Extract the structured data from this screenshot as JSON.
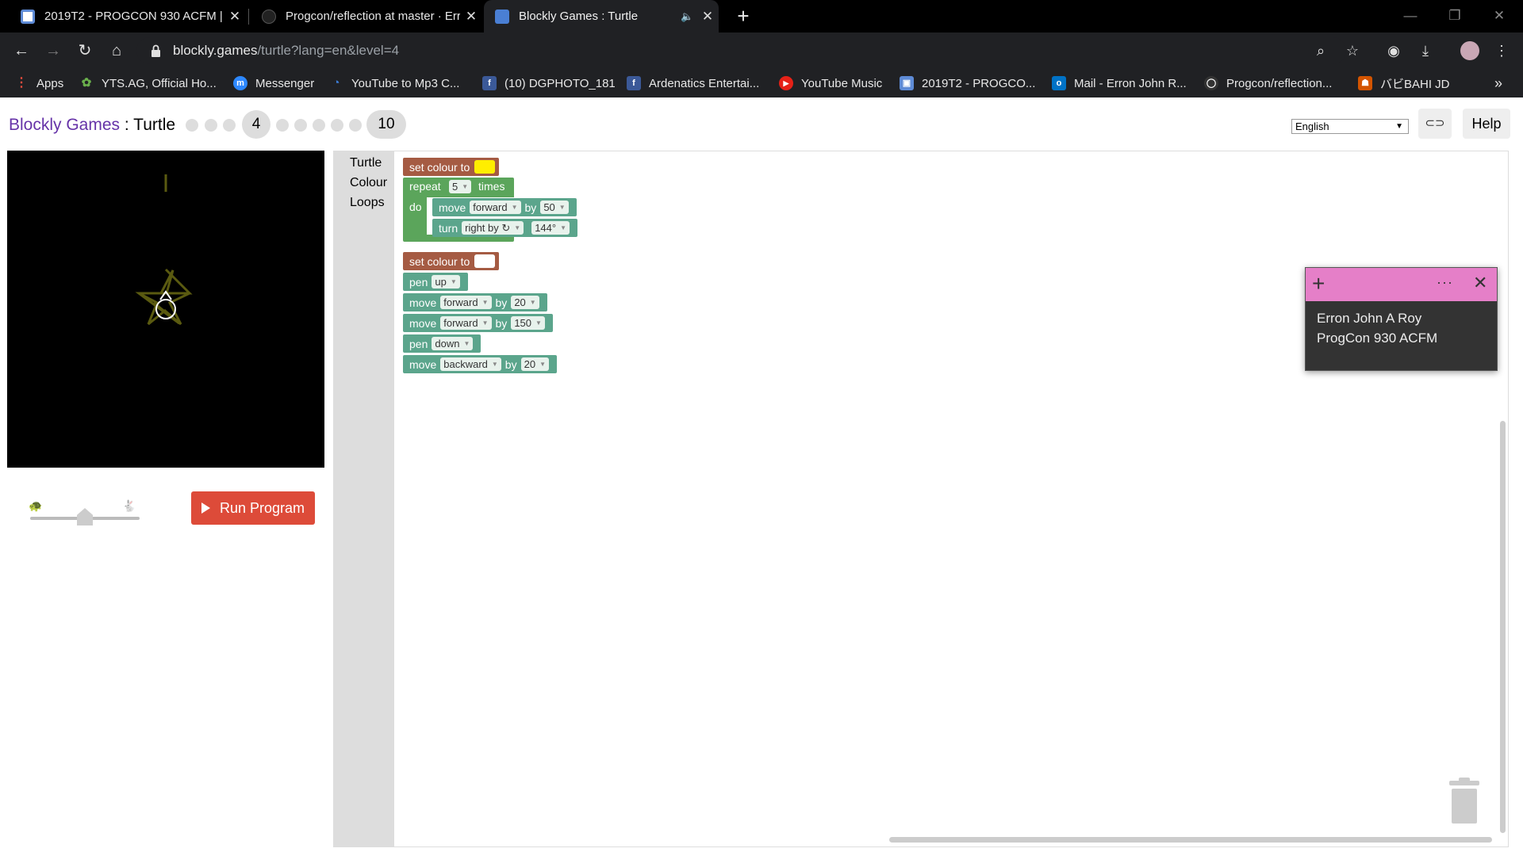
{
  "tabs": [
    {
      "title": "2019T2 - PROGCON 930 ACFM |",
      "close": "✕",
      "favicon_color": "#5e8bd6"
    },
    {
      "title": "Progcon/reflection at master · Err",
      "close": "✕",
      "favicon_color": "#333333"
    },
    {
      "title": "Blockly Games : Turtle",
      "close": "✕",
      "favicon_color": "#4a7fd4",
      "audio": "🔈"
    }
  ],
  "new_tab": "+",
  "window_controls": {
    "minimize": "—",
    "maximize": "❐",
    "close": "✕"
  },
  "address": {
    "host": "blockly.games",
    "path": "/turtle?lang=en&level=4"
  },
  "bookmarks": [
    {
      "label": "Apps",
      "color": "#e84c3d",
      "glyph": "⋮"
    },
    {
      "label": "YTS.AG, Official Ho...",
      "color": "#6ab04c",
      "glyph": "✿"
    },
    {
      "label": "Messenger",
      "color": "#2d88ff",
      "glyph": "m"
    },
    {
      "label": "YouTube to Mp3 C...",
      "color": "#3b7dd8",
      "glyph": "◔"
    },
    {
      "label": "(10) DGPHOTO_181",
      "color": "#3b5998",
      "glyph": "f"
    },
    {
      "label": "Ardenatics Entertai...",
      "color": "#3b5998",
      "glyph": "f"
    },
    {
      "label": "YouTube Music",
      "color": "#e62117",
      "glyph": "▶"
    },
    {
      "label": "2019T2 - PROGCO...",
      "color": "#5e8bd6",
      "glyph": "▣"
    },
    {
      "label": "Mail - Erron John R...",
      "color": "#0072c6",
      "glyph": "o"
    },
    {
      "label": "Progcon/reflection...",
      "color": "#333333",
      "glyph": "◯"
    },
    {
      "label": "バビBAHI JD",
      "color": "#d35400",
      "glyph": "☗"
    }
  ],
  "bookmarks_more": "»",
  "page": {
    "brand": "Blockly Games",
    "separator": " : ",
    "game": "Turtle",
    "current_level": "4",
    "last_level": "10",
    "language": "English",
    "help": "Help",
    "run_button": "Run Program"
  },
  "toolbox": [
    "Turtle",
    "Colour",
    "Loops"
  ],
  "blocks": {
    "set_colour_1": {
      "label": "set colour to",
      "color": "#ffee00"
    },
    "repeat": {
      "label": "repeat",
      "count": "5",
      "times": "times",
      "do": "do"
    },
    "move_1": {
      "label": "move",
      "dir": "forward",
      "by": "by",
      "value": "50"
    },
    "turn": {
      "label": "turn",
      "dir": "right by ↻",
      "value": "144°"
    },
    "set_colour_2": {
      "label": "set colour to",
      "color": "#ffffff"
    },
    "pen_up": {
      "label": "pen",
      "value": "up"
    },
    "move_2": {
      "label": "move",
      "dir": "forward",
      "by": "by",
      "value": "20"
    },
    "move_3": {
      "label": "move",
      "dir": "forward",
      "by": "by",
      "value": "150"
    },
    "pen_down": {
      "label": "pen",
      "value": "down"
    },
    "move_4": {
      "label": "move",
      "dir": "backward",
      "by": "by",
      "value": "20"
    }
  },
  "sticky_note": {
    "lines": [
      "Erron John A Roy",
      "ProgCon 930 ACFM"
    ],
    "accent": "#e57fc8"
  }
}
